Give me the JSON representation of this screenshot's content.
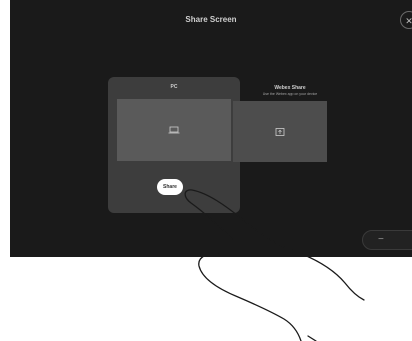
{
  "screen": {
    "title": "Share Screen",
    "close_icon": "close-icon"
  },
  "sources": [
    {
      "label": "PC",
      "preview_icon": "laptop-icon",
      "share_button": "Share",
      "selected": true
    },
    {
      "label": "Webex Share",
      "description": "Use the Webex app on your device",
      "preview_icon": "webex-share-icon"
    }
  ],
  "volume": {
    "decrease_icon": "volume-down-icon",
    "increase_icon": "volume-up-icon"
  },
  "illustration": {
    "icon": "pointing-hand-icon"
  },
  "colors": {
    "screen_bg": "#1a1a1a",
    "card_bg": "#3d3d3d",
    "preview_bg": "#5a5a5a",
    "button_bg": "#ffffff"
  }
}
